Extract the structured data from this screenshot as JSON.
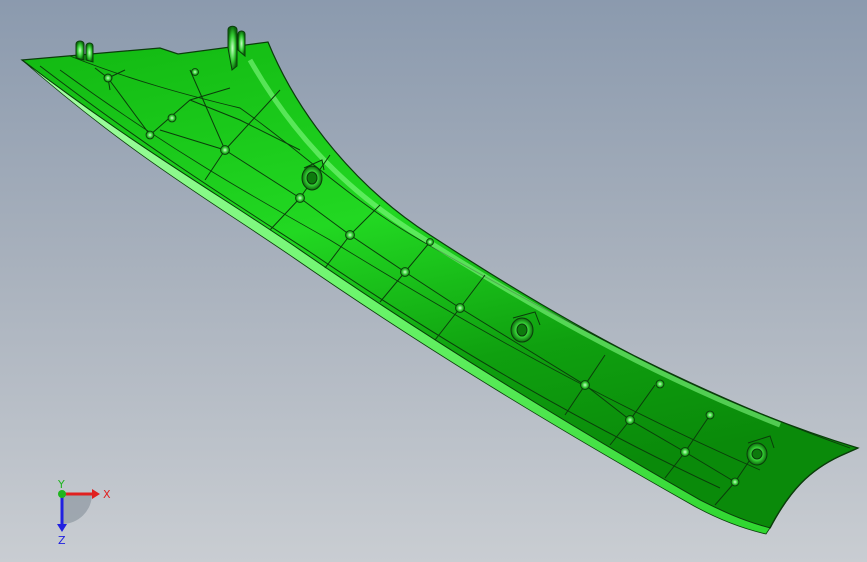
{
  "viewport": {
    "background_top": "#8b9aae",
    "background_bottom": "#c9cdd2"
  },
  "model": {
    "body_color": "#19d219",
    "highlight_color": "#7dff7d",
    "shadow_color": "#0a8c0a",
    "edge_color": "#0b3d0b"
  },
  "triad": {
    "x_label": "X",
    "y_label": "Y",
    "z_label": "Z",
    "x_color": "#e0201f",
    "y_color": "#1fb51f",
    "z_color": "#2020e0"
  }
}
